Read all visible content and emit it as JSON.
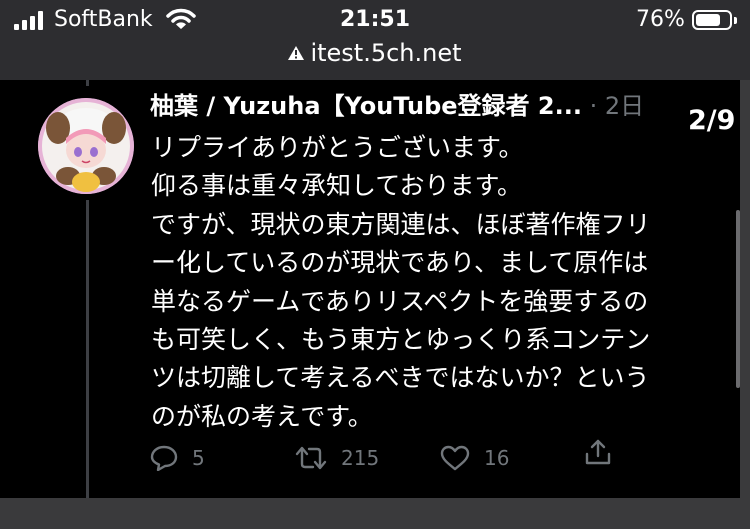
{
  "status_bar": {
    "carrier": "SoftBank",
    "time": "21:51",
    "battery_percent": "76%",
    "battery_level": 0.76,
    "url": "itest.5ch.net"
  },
  "tweet": {
    "author": "柚葉 / Yuzuha【YouTube登録者 2...",
    "separator": "·",
    "date": "2日",
    "page_counter": "2/9",
    "lines": [
      "リプライありがとうございます。",
      "仰る事は重々承知しております。",
      "ですが、現状の東方関連は、ほぼ著作権フリ",
      "ー化しているのが現状であり、まして原作は",
      "単なるゲームでありリスペクトを強要するの",
      "も可笑しく、もう東方とゆっくり系コンテン",
      "ツは切離して考えるべきではないか？という",
      "のが私の考えです。"
    ],
    "actions": {
      "reply_count": "5",
      "retweet_count": "215",
      "like_count": "16"
    }
  }
}
